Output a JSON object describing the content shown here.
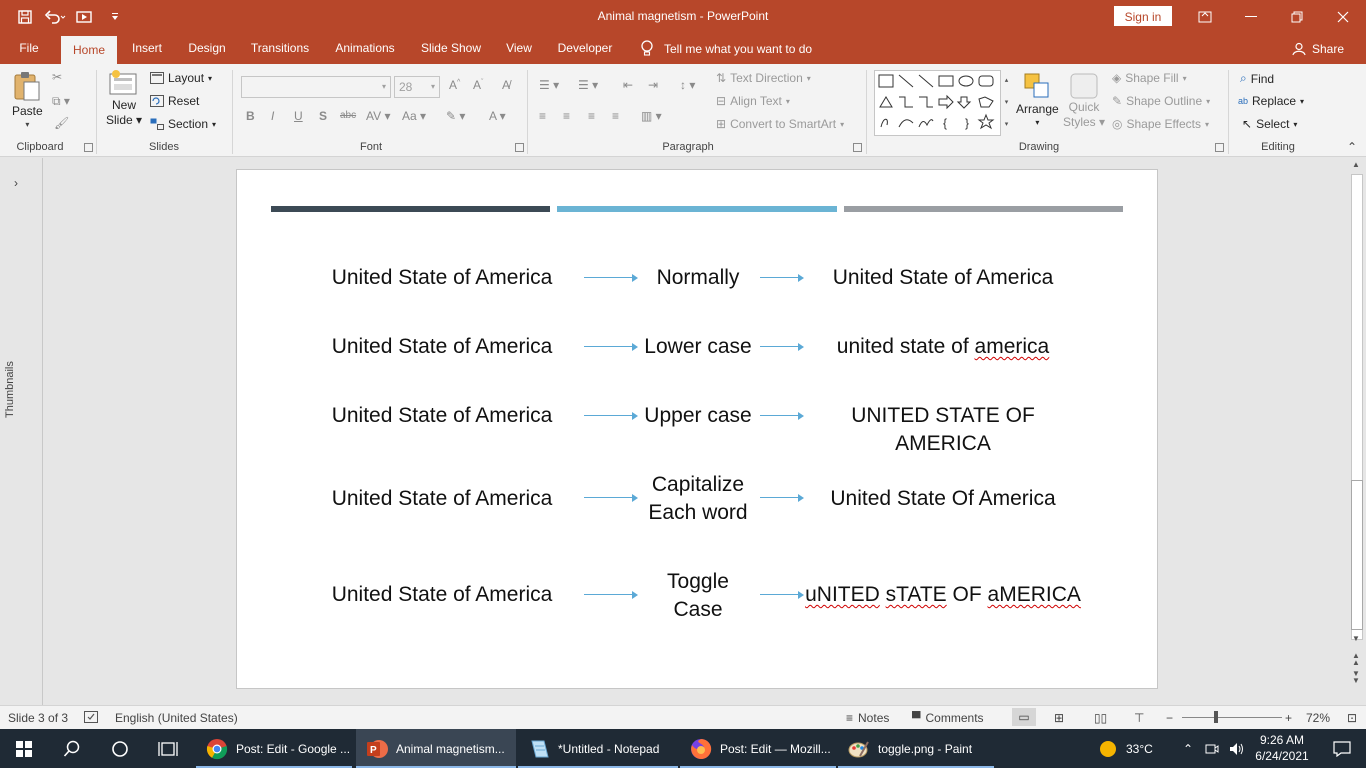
{
  "app": {
    "title": "Animal magnetism  -  PowerPoint",
    "sign_in": "Sign in"
  },
  "tabs": [
    {
      "label": "File"
    },
    {
      "label": "Home"
    },
    {
      "label": "Insert"
    },
    {
      "label": "Design"
    },
    {
      "label": "Transitions"
    },
    {
      "label": "Animations"
    },
    {
      "label": "Slide Show"
    },
    {
      "label": "View"
    },
    {
      "label": "Developer"
    }
  ],
  "tell_me": "Tell me what you want to do",
  "share": "Share",
  "ribbon": {
    "clipboard": {
      "paste": "Paste",
      "label": "Clipboard"
    },
    "slides": {
      "new_slide_1": "New",
      "new_slide_2": "Slide",
      "layout": "Layout",
      "reset": "Reset",
      "section": "Section",
      "label": "Slides"
    },
    "font": {
      "size": "28",
      "label": "Font"
    },
    "paragraph": {
      "text_direction": "Text Direction",
      "align_text": "Align Text",
      "convert_smartart": "Convert to SmartArt",
      "label": "Paragraph"
    },
    "drawing": {
      "arrange": "Arrange",
      "quick_styles_1": "Quick",
      "quick_styles_2": "Styles",
      "shape_fill": "Shape Fill",
      "shape_outline": "Shape Outline",
      "shape_effects": "Shape Effects",
      "label": "Drawing"
    },
    "editing": {
      "find": "Find",
      "replace": "Replace",
      "select": "Select",
      "label": "Editing"
    }
  },
  "thumbnails_label": "Thumbnails",
  "slide": {
    "bar_colors": [
      "#3c4a55",
      "#6bb4d4",
      "#9a9ea3"
    ],
    "rows": [
      {
        "source": "United State of America",
        "method": "Normally",
        "result": "United State of America"
      },
      {
        "source": "United State of America",
        "method": "Lower case",
        "result_parts": [
          "united state of ",
          "america"
        ]
      },
      {
        "source": "United State of America",
        "method": "Upper case",
        "result": "UNITED STATE OF AMERICA"
      },
      {
        "source": "United State of America",
        "method_lines": [
          "Capitalize",
          "Each word"
        ],
        "result": "United State Of America"
      },
      {
        "source": "United State of America",
        "method_lines": [
          "Toggle",
          "Case"
        ],
        "result_parts": [
          "uNITED",
          " ",
          "sTATE",
          " OF ",
          "aMERICA"
        ]
      }
    ]
  },
  "status": {
    "slide_info": "Slide 3 of 3",
    "language": "English (United States)",
    "notes": "Notes",
    "comments": "Comments",
    "zoom": "72%"
  },
  "taskbar": {
    "items": [
      {
        "label": "Post: Edit - Google ..."
      },
      {
        "label": "Animal magnetism..."
      },
      {
        "label": "*Untitled - Notepad"
      },
      {
        "label": "Post: Edit — Mozill..."
      },
      {
        "label": "toggle.png - Paint"
      }
    ],
    "temperature": "33°C",
    "time": "9:26 AM",
    "date": "6/24/2021"
  }
}
